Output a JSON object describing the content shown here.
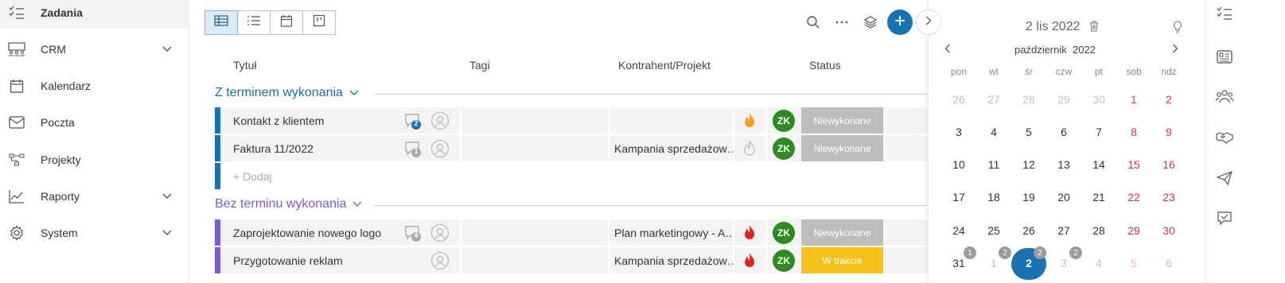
{
  "sidebar": {
    "items": [
      {
        "label": "Zadania",
        "icon": "tasks-icon",
        "active": true
      },
      {
        "label": "CRM",
        "icon": "crm-icon"
      },
      {
        "label": "Kalendarz",
        "icon": "calendar-icon"
      },
      {
        "label": "Poczta",
        "icon": "mail-icon"
      },
      {
        "label": "Projekty",
        "icon": "projects-icon"
      },
      {
        "label": "Raporty",
        "icon": "chart-icon"
      },
      {
        "label": "System",
        "icon": "gear-icon"
      }
    ]
  },
  "main": {
    "columns": {
      "title": "Tytuł",
      "tags": "Tagi",
      "contractor": "Kontrahent/Projekt",
      "status": "Status"
    },
    "groups": [
      {
        "label": "Z terminem wykonania",
        "color": "#1f6fa6",
        "rows": [
          {
            "title": "Kontakt z klientem",
            "comments": "2",
            "project": "",
            "avatar": "ZK",
            "status": "Niewykonane",
            "priority": "high",
            "bar": "#1a73b0"
          },
          {
            "title": "Faktura 11/2022",
            "comments": "1",
            "project": "Kampania sprzedażow…",
            "avatar": "ZK",
            "status": "Niewykonane",
            "priority": "none",
            "bar": "#1a73b0"
          }
        ],
        "add_label": "+ Dodaj"
      },
      {
        "label": "Bez terminu wykonania",
        "color": "#7b5cd6",
        "rows": [
          {
            "title": "Zaprojektowanie nowego logo",
            "comments": "4",
            "project": "Plan marketingowy - A…",
            "avatar": "ZK",
            "status": "Niewykonane",
            "priority": "urgent",
            "bar": "#7b5cd6"
          },
          {
            "title": "Przygotowanie reklam",
            "comments": "",
            "project": "Kampania sprzedażow…",
            "avatar": "ZK",
            "status": "W trakcie",
            "priority": "urgent",
            "bar": "#7b5cd6"
          }
        ]
      }
    ],
    "colors": {
      "status_not_done": "#bdbdbd",
      "status_in_progress": "#f5c21b",
      "avatar": "#2e8b1f",
      "accent": "#1a73b0"
    }
  },
  "calendar": {
    "selected_date": "2 lis 2022",
    "month_label": "październik",
    "year_label": "2022",
    "weekdays": [
      "pon",
      "wt",
      "śr",
      "czw",
      "pt",
      "sob",
      "ndz"
    ],
    "weeks": [
      [
        "26",
        "27",
        "28",
        "29",
        "30",
        "1",
        "2"
      ],
      [
        "3",
        "4",
        "5",
        "6",
        "7",
        "8",
        "9"
      ],
      [
        "10",
        "11",
        "12",
        "13",
        "14",
        "15",
        "16"
      ],
      [
        "17",
        "18",
        "19",
        "20",
        "21",
        "22",
        "23"
      ],
      [
        "24",
        "25",
        "26",
        "27",
        "28",
        "29",
        "30"
      ],
      [
        "31",
        "1",
        "2",
        "3",
        "4",
        "5",
        "6"
      ]
    ],
    "badges": {
      "31": "1",
      "1": "2",
      "2": "2",
      "3": "2"
    }
  }
}
